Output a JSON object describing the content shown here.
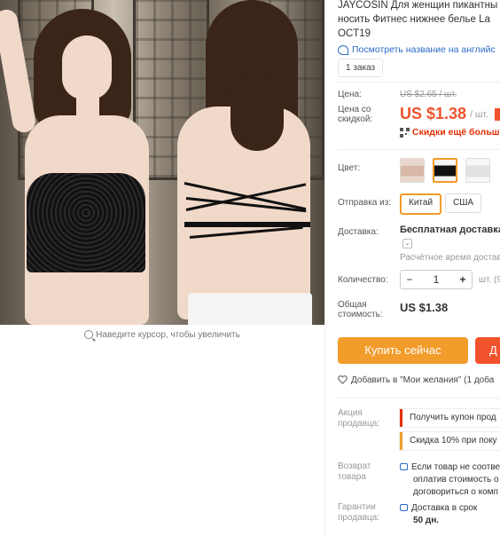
{
  "product": {
    "title_lines": [
      "JAYCOSIN Для женщин пикантны",
      "носить Фитнес нижнее белье La",
      "OCT19"
    ],
    "translate_link": "Посмотреть название на английс",
    "orders": "1 заказ"
  },
  "image": {
    "zoom_hint": "Наведите курсор, чтобы увеличить"
  },
  "price": {
    "label": "Цена:",
    "old": "US $2.65 / шт.",
    "discount_label": "Цена со скидкой:",
    "current": "US $1.38",
    "unit": "/ шт.",
    "coupon_text": "Скидки ещё больше н"
  },
  "options": {
    "color_label": "Цвет:",
    "colors": [
      "nude",
      "black",
      "white"
    ],
    "ship_from_label": "Отправка из:",
    "ship_from": [
      "Китай",
      "США"
    ],
    "ship_from_selected": 0
  },
  "delivery": {
    "label": "Доставка:",
    "method": "Бесплатная доставка в",
    "time": "Расчётное время достав"
  },
  "quantity": {
    "label": "Количество:",
    "value": "1",
    "minus": "−",
    "plus": "+",
    "unit": "шт. (9"
  },
  "total": {
    "label": "Общая стоимость:",
    "value": "US $1.38"
  },
  "actions": {
    "buy_now": "Купить сейчас",
    "add_to_cart": "Д",
    "wishlist": "Добавить в \"Мои желания\" (1 доба"
  },
  "seller": {
    "promo_label": "Акция продавца:",
    "promo_coupon": "Получить купон прод",
    "promo_discount": "Скидка 10% при поку",
    "return_label": "Возврат товара",
    "return_lines": [
      "Если товар не соотве",
      "оплатив стоимость о",
      "договориться о комп"
    ],
    "guarantee_label": "Гарантии продавца:",
    "guarantee_lines": [
      "Доставка в срок",
      "50 дн."
    ]
  },
  "colors": {
    "accent_orange": "#f29c2b",
    "price_red": "#f0532b",
    "link_blue": "#2a6bc7"
  }
}
